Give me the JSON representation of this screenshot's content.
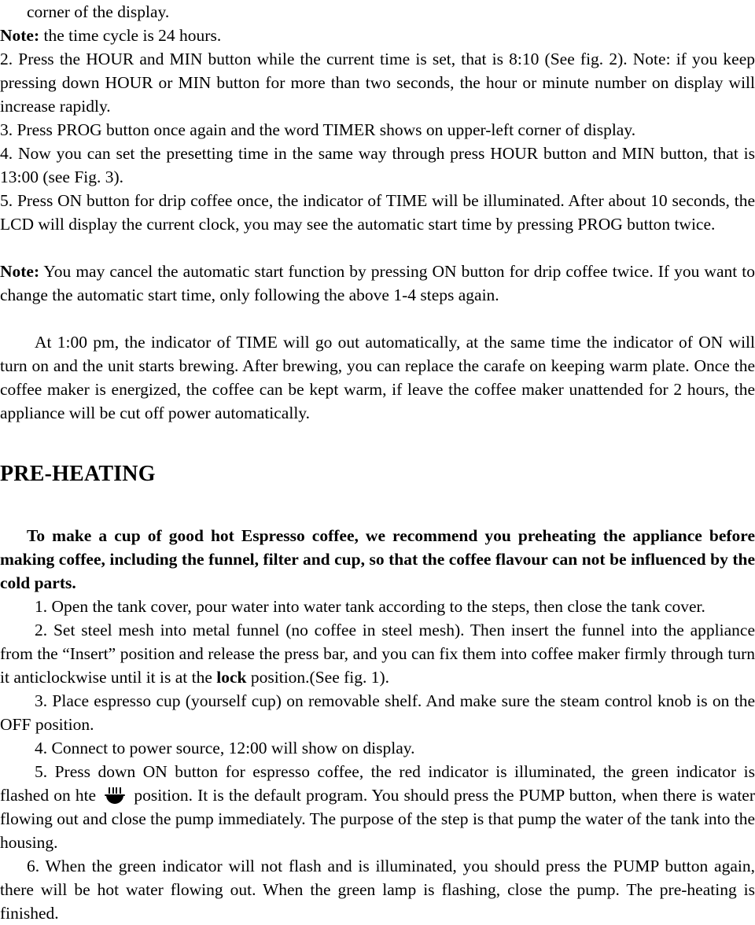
{
  "document": {
    "type": "scanned-instruction-manual-page",
    "language": "en",
    "font_style": "serif",
    "text_color": "#000000",
    "background_color": "#ffffff"
  },
  "content": {
    "line_corner_of_display": "corner of the display.",
    "note1_label": "Note:",
    "note1_text": " the time cycle is 24 hours.",
    "step2": "2. Press the HOUR and MIN button while the current time is set, that is 8:10 (See fig. 2). Note: if you keep pressing down HOUR or MIN button for more than two seconds, the hour or minute number on display will increase rapidly.",
    "step3": "3. Press PROG button once again and the word TIMER shows on upper-left corner of display.",
    "step4": "4. Now you can set the presetting time in the same way through press HOUR button and MIN button, that is 13:00 (see Fig. 3).",
    "step5": "5. Press ON button for drip coffee once, the indicator of TIME will be illuminated. After about 10 seconds, the LCD will display the current clock, you may see the automatic start time by pressing PROG button twice.",
    "note2_label": "Note:",
    "note2_text": " You may cancel the automatic start function by pressing ON button for drip coffee twice. If you want to change the automatic start time, only following the above 1-4 steps again.",
    "para_at_1pm": "At 1:00 pm, the indicator of TIME will go out automatically, at the same time the indicator of ON will turn on and the unit starts brewing. After brewing, you can replace the carafe on keeping warm plate. Once the coffee maker is energized, the coffee can be kept warm, if leave the coffee maker unattended for 2 hours, the appliance will be cut off power automatically.",
    "heading_preheating": "PRE-HEATING",
    "preheat_intro": "To make a cup of good hot Espresso coffee, we recommend you preheating the appliance before making coffee, including the funnel, filter and cup, so that the coffee flavour can not be influenced by the cold parts.",
    "ph_step1": "1. Open the tank cover, pour water into water tank according to the steps, then close the tank cover.",
    "ph_step2_a": "2. Set steel mesh into metal funnel (no coffee in steel mesh). Then insert the funnel into the appliance from the “Insert” position and release the press bar, and you can fix them into coffee maker firmly through turn it anticlockwise until it is at the ",
    "ph_step2_bold": "lock",
    "ph_step2_b": " position.(See fig. 1).",
    "ph_step3": "3. Place espresso cup (yourself cup) on removable shelf. And make sure the steam control knob is on the OFF position.",
    "ph_step4": "4. Connect to power source, 12:00 will show on display.",
    "ph_step5_a": "5. Press down ON button for espresso coffee, the red indicator is illuminated, the green indicator is flashed on hte ",
    "ph_step5_icon": "steaming-cup-icon",
    "ph_step5_b": " position. It is the default program. You should press the PUMP button, when there is water flowing out and close the pump immediately. The purpose of the step is that pump the water of the tank into the housing.",
    "ph_step6": "6. When the green indicator will not flash and is illuminated, you should press the PUMP button again, there will be hot water flowing out. When the green lamp is flashing, close the pump. The pre-heating is finished."
  }
}
